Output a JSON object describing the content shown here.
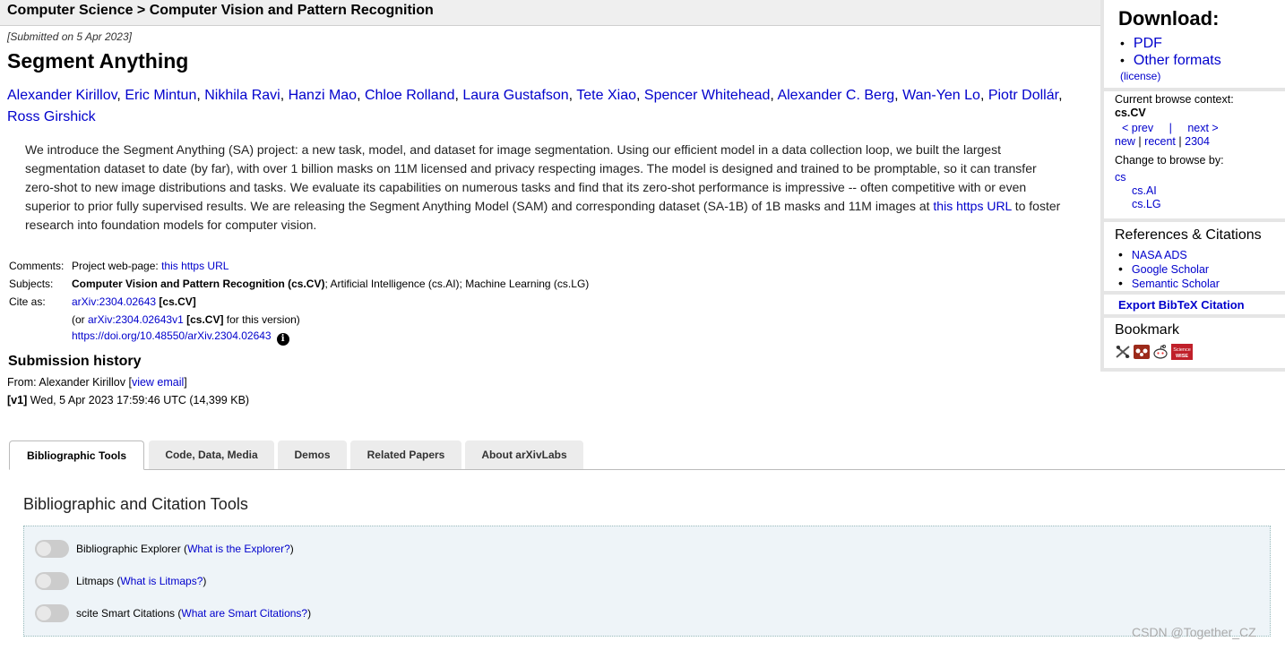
{
  "breadcrumb": "Computer Science > Computer Vision and Pattern Recognition",
  "dateline": "[Submitted on 5 Apr 2023]",
  "title": "Segment Anything",
  "authors": [
    "Alexander Kirillov",
    "Eric Mintun",
    "Nikhila Ravi",
    "Hanzi Mao",
    "Chloe Rolland",
    "Laura Gustafson",
    "Tete Xiao",
    "Spencer Whitehead",
    "Alexander C. Berg",
    "Wan-Yen Lo",
    "Piotr Dollár",
    "Ross Girshick"
  ],
  "abstract": {
    "text_before": "We introduce the Segment Anything (SA) project: a new task, model, and dataset for image segmentation. Using our efficient model in a data collection loop, we built the largest segmentation dataset to date (by far), with over 1 billion masks on 11M licensed and privacy respecting images. The model is designed and trained to be promptable, so it can transfer zero-shot to new image distributions and tasks. We evaluate its capabilities on numerous tasks and find that its zero-shot performance is impressive -- often competitive with or even superior to prior fully supervised results. We are releasing the Segment Anything Model (SAM) and corresponding dataset (SA-1B) of 1B masks and 11M images at ",
    "link": "this https URL",
    "text_after": " to foster research into foundation models for computer vision."
  },
  "meta": {
    "comments_label": "Comments:",
    "comments_prefix": "Project web-page: ",
    "comments_link": "this https URL",
    "subjects_label": "Subjects:",
    "subjects_primary": "Computer Vision and Pattern Recognition (cs.CV)",
    "subjects_rest": "; Artificial Intelligence (cs.AI); Machine Learning (cs.LG)",
    "cite_label": "Cite as:",
    "cite_id": "arXiv:2304.02643",
    "cite_tag": "[cs.CV]",
    "cite_version_prefix": "(or ",
    "cite_version_id": "arXiv:2304.02643v1",
    "cite_version_tag": "[cs.CV]",
    "cite_version_suffix": " for this version)",
    "doi": "https://doi.org/10.48550/arXiv.2304.02643",
    "info_glyph": "i"
  },
  "submission": {
    "heading": "Submission history",
    "from_prefix": "From: Alexander Kirillov [",
    "from_link": "view email",
    "from_suffix": "]",
    "v1_tag": "[v1]",
    "v1_text": " Wed, 5 Apr 2023 17:59:46 UTC (14,399 KB)"
  },
  "tabs": [
    "Bibliographic Tools",
    "Code, Data, Media",
    "Demos",
    "Related Papers",
    "About arXivLabs"
  ],
  "biblio": {
    "heading": "Bibliographic and Citation Tools",
    "tools": [
      {
        "label": "Bibliographic Explorer (",
        "link": "What is the Explorer?",
        "end": ")"
      },
      {
        "label": "Litmaps (",
        "link": "What is Litmaps?",
        "end": ")"
      },
      {
        "label": "scite Smart Citations (",
        "link": "What are Smart Citations?",
        "end": ")"
      }
    ]
  },
  "sidebar": {
    "download_heading": "Download:",
    "pdf": "PDF",
    "other_formats": "Other formats",
    "license": "(license)",
    "context_label": "Current browse context:",
    "context_value": "cs.CV",
    "prev": "< prev",
    "nav_sep": "|",
    "next": "next >",
    "new": "new",
    "recent": "recent",
    "month": "2304",
    "change_label": "Change to browse by:",
    "browse_cs": "cs",
    "browse_ai": "cs.AI",
    "browse_lg": "cs.LG",
    "refs_heading": "References & Citations",
    "refs": [
      "NASA ADS",
      "Google Scholar",
      "Semantic Scholar"
    ],
    "bibtex": "Export BibTeX Citation",
    "bookmark_heading": "Bookmark",
    "bookmark_icons": [
      "bibsonomy-icon",
      "mendeley-icon",
      "reddit-icon",
      "sciencewise-icon"
    ],
    "sciencewise_text_top": "Science",
    "sciencewise_text_bottom": "WISE"
  },
  "watermark": "CSDN @Together_CZ",
  "colors": {
    "link": "#0000cc",
    "header_bg": "#efefef",
    "toolbox_bg": "#eef4f8",
    "tab_bg": "#ececec"
  }
}
